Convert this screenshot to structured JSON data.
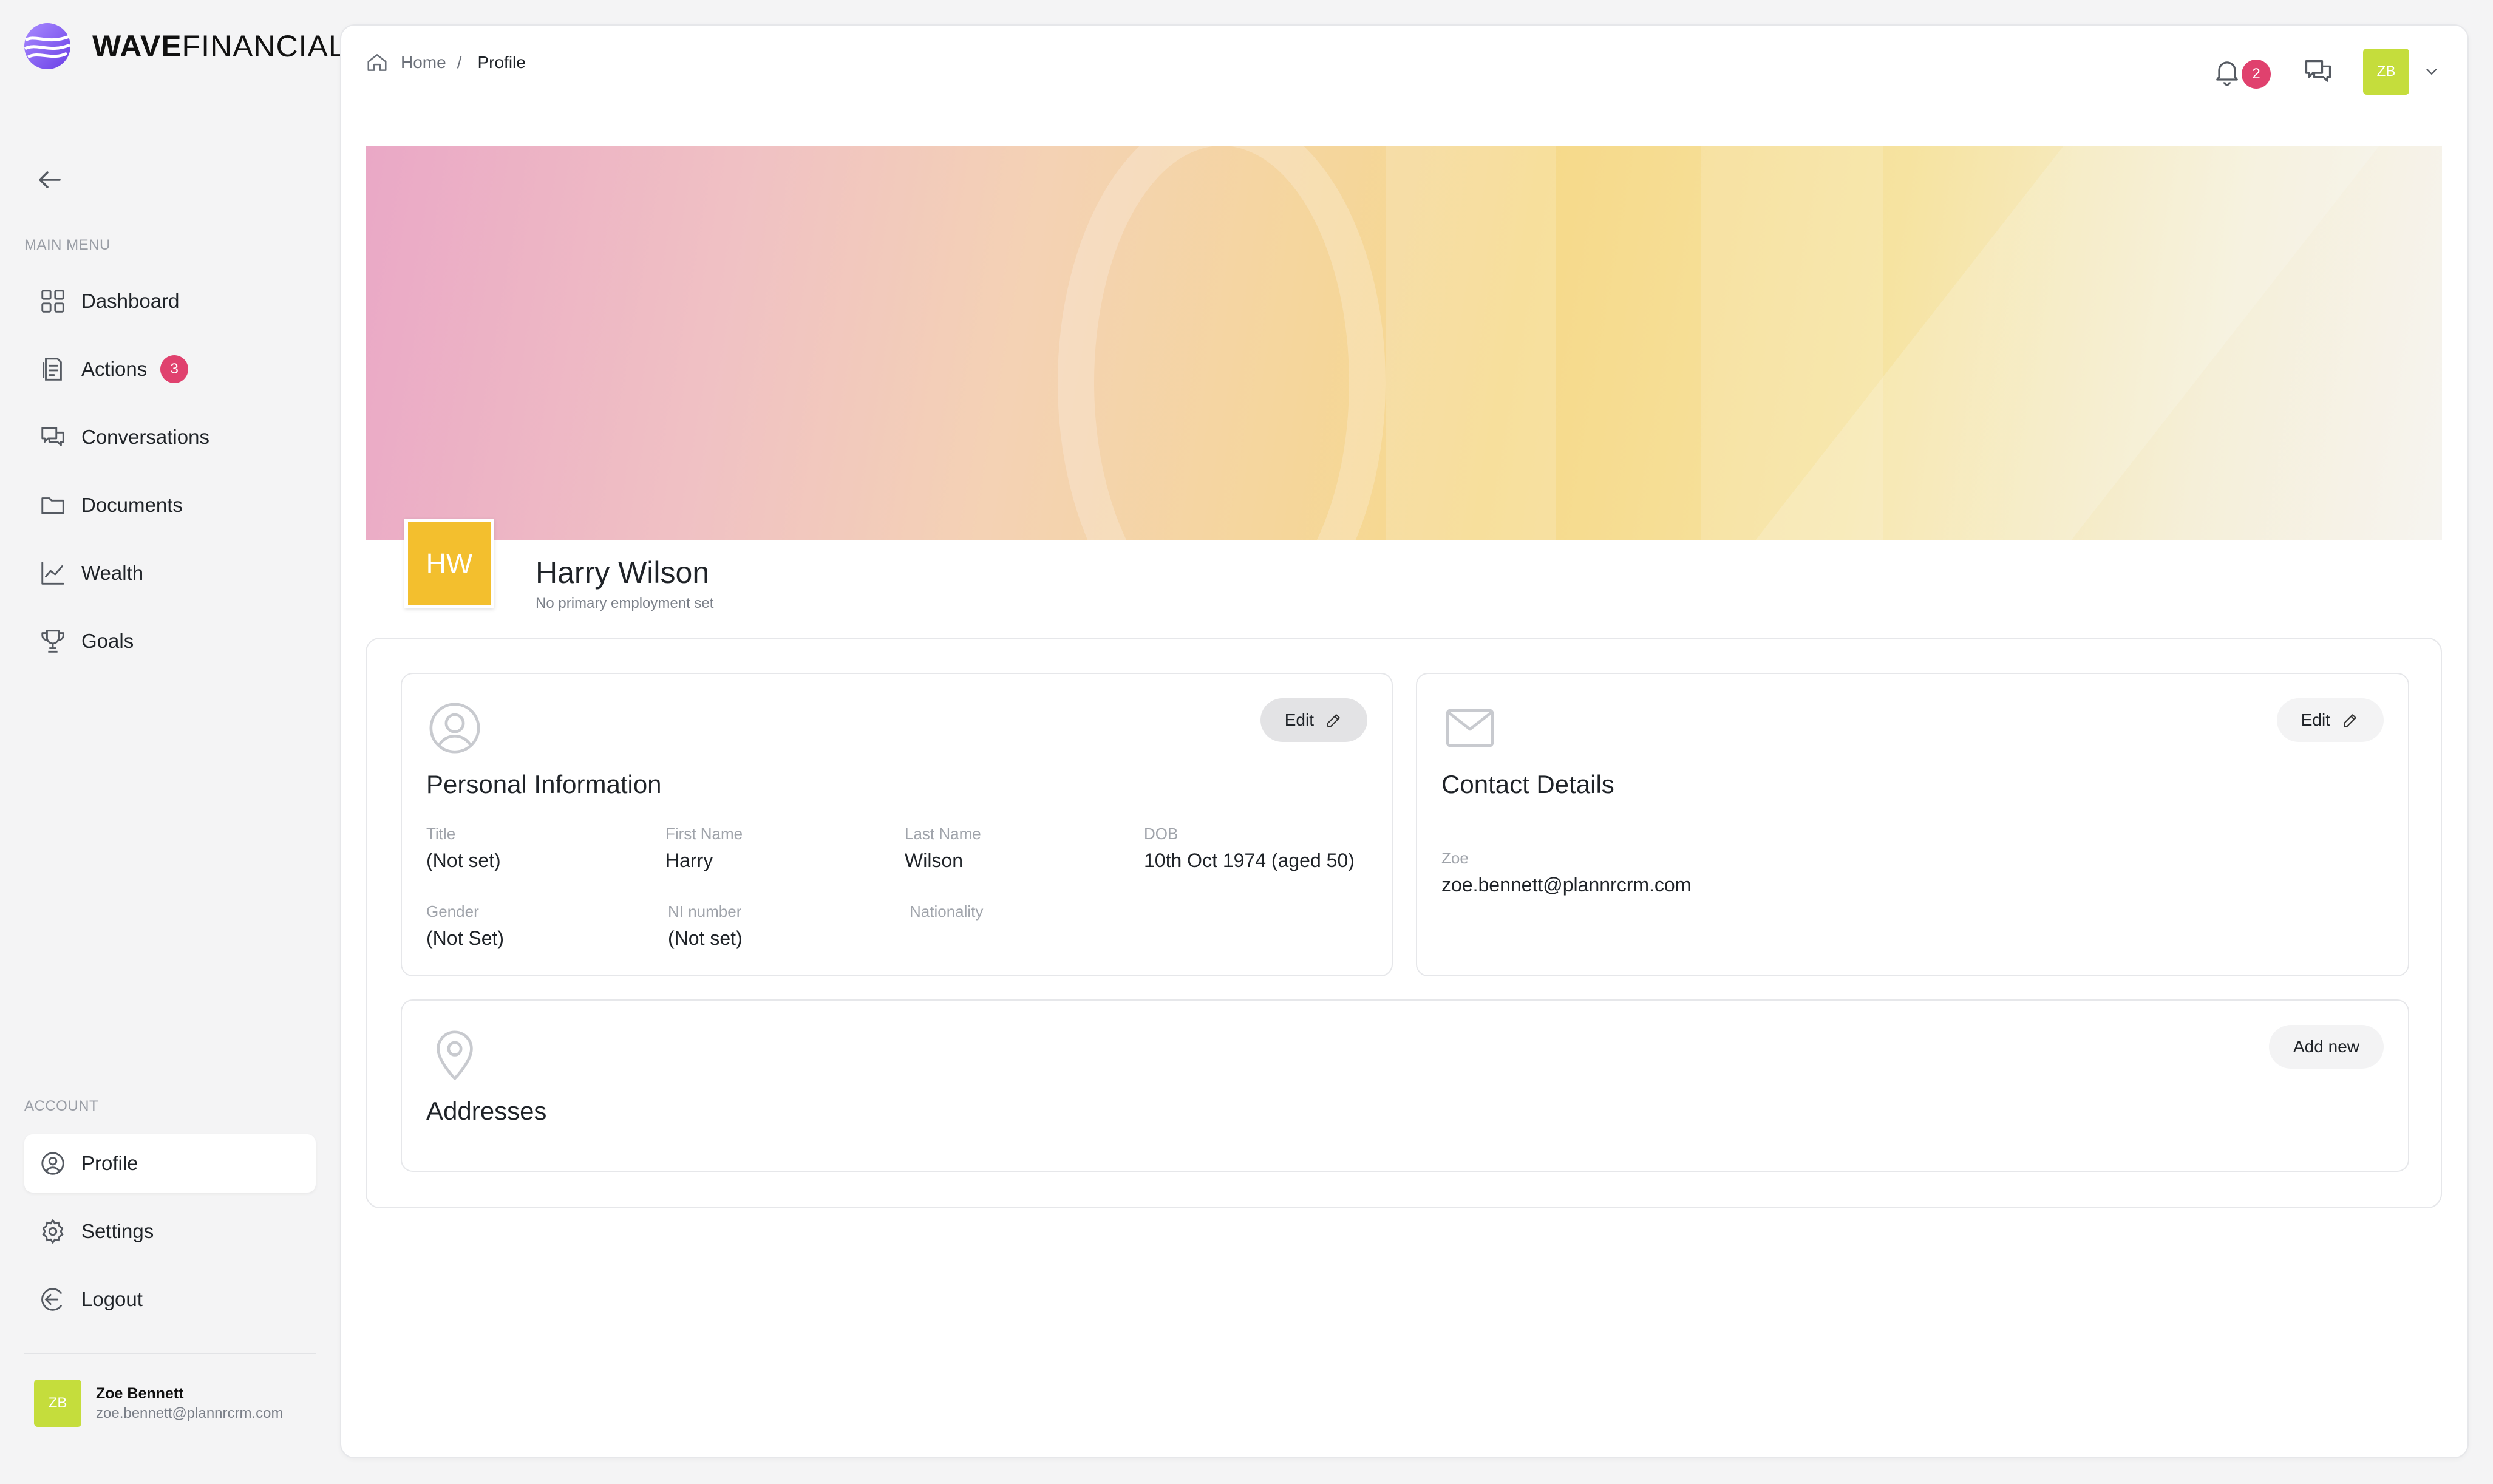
{
  "brand": {
    "name_bold": "WAVE",
    "name_light": "FINANCIAL"
  },
  "sidebar": {
    "main_menu_label": "MAIN MENU",
    "account_label": "ACCOUNT",
    "items": [
      {
        "label": "Dashboard",
        "icon": "grid-icon"
      },
      {
        "label": "Actions",
        "icon": "checklist-icon",
        "badge": "3"
      },
      {
        "label": "Conversations",
        "icon": "chat-bubbles-icon"
      },
      {
        "label": "Documents",
        "icon": "folder-icon"
      },
      {
        "label": "Wealth",
        "icon": "chart-line-icon"
      },
      {
        "label": "Goals",
        "icon": "trophy-icon"
      }
    ],
    "account_items": [
      {
        "label": "Profile",
        "icon": "user-circle-icon",
        "active": true
      },
      {
        "label": "Settings",
        "icon": "gear-icon"
      },
      {
        "label": "Logout",
        "icon": "logout-icon"
      }
    ],
    "user": {
      "initials": "ZB",
      "name": "Zoe Bennett",
      "email": "zoe.bennett@plannrcrm.com"
    }
  },
  "header": {
    "breadcrumb": {
      "home": "Home",
      "separator": "/",
      "current": "Profile"
    },
    "notifications_count": "2",
    "avatar_initials": "ZB"
  },
  "profile": {
    "initials": "HW",
    "name": "Harry Wilson",
    "subtitle": "No primary employment set"
  },
  "personal_info": {
    "title": "Personal Information",
    "edit_label": "Edit",
    "fields": [
      {
        "label": "Title",
        "value": "(Not set)"
      },
      {
        "label": "First Name",
        "value": "Harry"
      },
      {
        "label": "Last Name",
        "value": "Wilson"
      },
      {
        "label": "DOB",
        "value": "10th Oct 1974 (aged 50)"
      },
      {
        "label": "Gender",
        "value": "(Not Set)"
      },
      {
        "label": "NI number",
        "value": "(Not set)"
      },
      {
        "label": "Nationality",
        "value": ""
      }
    ]
  },
  "contact": {
    "title": "Contact Details",
    "edit_label": "Edit",
    "email_label": "Zoe",
    "email_value": "zoe.bennett@plannrcrm.com"
  },
  "addresses": {
    "title": "Addresses",
    "add_label": "Add new"
  },
  "colors": {
    "accent_badge": "#e0416e",
    "avatar_green": "#c5dd3c",
    "avatar_yellow": "#f3bf2e",
    "brand_purple": "#7b5cf0"
  }
}
